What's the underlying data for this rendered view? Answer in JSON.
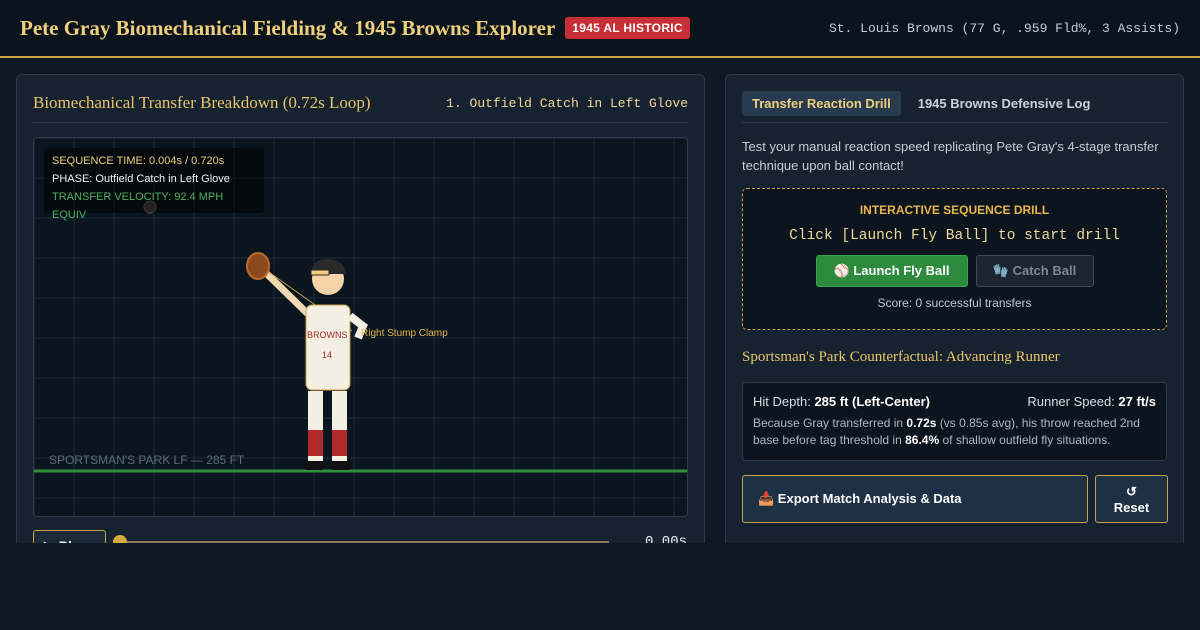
{
  "header": {
    "title": "Pete Gray Biomechanical Fielding & 1945 Browns Explorer",
    "badge": "1945 AL HISTORIC",
    "team_stat": "St. Louis Browns (77 G, .959 Fld%, 3 Assists)"
  },
  "left_panel": {
    "title": "Biomechanical Transfer Breakdown (0.72s Loop)",
    "phase_heading": "1. Outfield Catch in Left Glove",
    "readout": {
      "sequence": "SEQUENCE TIME: 0.004s / 0.720s",
      "phase": "PHASE: Outfield Catch in Left Glove",
      "velocity": "TRANSFER VELOCITY: 92.4 MPH EQUIV"
    },
    "stage": {
      "field_label": "SPORTSMAN'S PARK LF — 285 FT",
      "jersey_text": "BROWNS",
      "jersey_number": "14",
      "stump_label": "Right Stump Clamp"
    },
    "controls": {
      "play_label": "▶ Play",
      "time": "0.00s",
      "progress": 0.0
    }
  },
  "right_panel": {
    "tabs": [
      "Transfer Reaction Drill",
      "1945 Browns Defensive Log"
    ],
    "intro": "Test your manual reaction speed replicating Pete Gray's 4-stage transfer technique upon ball contact!",
    "drill": {
      "heading": "INTERACTIVE SEQUENCE DRILL",
      "status": "Click [Launch Fly Ball] to start drill",
      "launch_label": "⚾ Launch Fly Ball",
      "catch_label": "🧤 Catch Ball",
      "score": "Score: 0 successful transfers"
    },
    "counterfactual": {
      "title": "Sportsman's Park Counterfactual: Advancing Runner",
      "hit_depth_label": "Hit Depth:",
      "hit_depth_value": "285 ft (Left-Center)",
      "runner_speed_label": "Runner Speed:",
      "runner_speed_value": "27 ft/s",
      "note_1": "Because Gray transferred in ",
      "note_time": "0.72s",
      "note_2": " (vs 0.85s avg), his throw reached 2nd base before tag threshold in ",
      "note_pct": "86.4%",
      "note_3": " of shallow outfield fly situations."
    },
    "actions": {
      "export_label": "📥 Export Match Analysis & Data",
      "reset_icon": "↺",
      "reset_label": "Reset"
    }
  },
  "colors": {
    "accent_gold": "#c9a24a",
    "badge_red": "#c62f36",
    "launch_green": "#2e8b3d"
  }
}
